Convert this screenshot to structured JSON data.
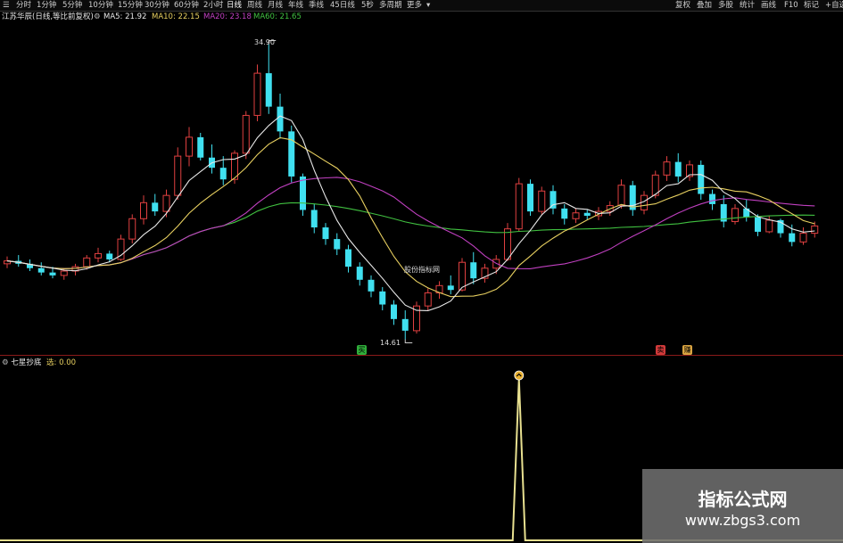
{
  "toolbar": {
    "items": [
      {
        "label": "分时"
      },
      {
        "label": "1分钟"
      },
      {
        "label": "5分钟"
      },
      {
        "label": "10分钟"
      },
      {
        "label": "15分钟"
      },
      {
        "label": "30分钟"
      },
      {
        "label": "60分钟"
      },
      {
        "label": "2小时"
      },
      {
        "label": "日线",
        "active": true
      },
      {
        "label": "周线"
      },
      {
        "label": "月线"
      },
      {
        "label": "年线"
      },
      {
        "label": "季线"
      },
      {
        "label": "45日线"
      },
      {
        "label": "5秒"
      },
      {
        "label": "多周期"
      },
      {
        "label": "更多"
      }
    ],
    "right_items": [
      {
        "label": "复权"
      },
      {
        "label": "叠加"
      },
      {
        "label": "多股"
      },
      {
        "label": "统计"
      },
      {
        "label": "画线"
      },
      {
        "label": "F10"
      },
      {
        "label": "标记"
      },
      {
        "label": "+自选"
      }
    ]
  },
  "stock": {
    "name": "江苏华辰(日线,等比前复权)"
  },
  "ma_legend": [
    {
      "label": "MA5: 21.92",
      "color": "#e8e8e8"
    },
    {
      "label": "MA10: 22.15",
      "color": "#e8d060"
    },
    {
      "label": "MA20: 23.18",
      "color": "#c040c0"
    },
    {
      "label": "MA60: 21.65",
      "color": "#40c040"
    }
  ],
  "annotations": {
    "high_label": "34.90",
    "low_label": "14.61",
    "note_label": "股份指标网"
  },
  "markers": [
    {
      "label": "买",
      "color": "#2fae3a"
    },
    {
      "label": "卖",
      "color": "#d03a3a"
    },
    {
      "label": "赚",
      "color": "#d9a441"
    }
  ],
  "indicator": {
    "name": "七星抄底",
    "value_label": "选: 0.00"
  },
  "watermark": {
    "title": "指标公式网",
    "url": "www.zbgs3.com"
  },
  "colors": {
    "up": "#e04040",
    "down": "#40e0f0",
    "ma5": "#e8e8e8",
    "ma10": "#e8d060",
    "ma20": "#c040c0",
    "ma60": "#40c040",
    "signal": "#e8e090"
  },
  "chart_data": {
    "type": "candlestick",
    "ohlc": [
      [
        19.8,
        20.3,
        19.5,
        20.0
      ],
      [
        20.0,
        20.4,
        19.6,
        19.8
      ],
      [
        19.8,
        20.1,
        19.3,
        19.5
      ],
      [
        19.5,
        19.9,
        19.0,
        19.2
      ],
      [
        19.2,
        19.6,
        18.8,
        19.0
      ],
      [
        19.0,
        19.5,
        18.7,
        19.3
      ],
      [
        19.3,
        19.8,
        19.0,
        19.6
      ],
      [
        19.6,
        20.4,
        19.4,
        20.2
      ],
      [
        20.2,
        20.9,
        19.9,
        20.5
      ],
      [
        20.5,
        20.7,
        19.9,
        20.1
      ],
      [
        20.1,
        21.8,
        20.0,
        21.5
      ],
      [
        21.5,
        23.2,
        21.2,
        22.9
      ],
      [
        22.9,
        24.5,
        22.5,
        24.0
      ],
      [
        24.0,
        24.6,
        23.1,
        23.4
      ],
      [
        23.4,
        24.9,
        23.0,
        24.5
      ],
      [
        24.5,
        27.8,
        24.2,
        27.2
      ],
      [
        27.2,
        29.2,
        26.5,
        28.5
      ],
      [
        28.5,
        28.8,
        26.9,
        27.1
      ],
      [
        27.1,
        28.0,
        26.0,
        26.4
      ],
      [
        26.4,
        27.2,
        25.2,
        25.6
      ],
      [
        25.6,
        27.6,
        25.3,
        27.4
      ],
      [
        27.4,
        30.3,
        27.0,
        30.0
      ],
      [
        30.0,
        33.5,
        29.6,
        32.9
      ],
      [
        32.9,
        34.9,
        30.1,
        30.6
      ],
      [
        30.6,
        31.5,
        28.4,
        28.9
      ],
      [
        28.9,
        29.3,
        25.4,
        25.8
      ],
      [
        25.8,
        26.0,
        23.1,
        23.5
      ],
      [
        23.5,
        23.9,
        21.9,
        22.3
      ],
      [
        22.3,
        22.6,
        21.1,
        21.5
      ],
      [
        21.5,
        21.9,
        20.4,
        20.8
      ],
      [
        20.8,
        21.1,
        19.2,
        19.6
      ],
      [
        19.6,
        19.9,
        18.3,
        18.7
      ],
      [
        18.7,
        19.0,
        17.5,
        17.9
      ],
      [
        17.9,
        18.2,
        16.6,
        17.0
      ],
      [
        17.0,
        17.3,
        15.6,
        16.0
      ],
      [
        16.0,
        16.6,
        14.61,
        15.2
      ],
      [
        15.2,
        17.2,
        15.0,
        16.9
      ],
      [
        16.9,
        18.1,
        16.6,
        17.8
      ],
      [
        17.8,
        18.6,
        17.4,
        18.3
      ],
      [
        18.3,
        19.0,
        17.7,
        18.0
      ],
      [
        18.0,
        20.2,
        17.9,
        19.9
      ],
      [
        19.9,
        20.6,
        18.4,
        18.8
      ],
      [
        18.8,
        19.8,
        18.5,
        19.5
      ],
      [
        19.5,
        20.4,
        19.1,
        20.1
      ],
      [
        20.1,
        22.6,
        20.0,
        22.2
      ],
      [
        22.2,
        25.7,
        22.0,
        25.3
      ],
      [
        25.3,
        25.6,
        23.1,
        23.4
      ],
      [
        23.4,
        25.1,
        23.2,
        24.8
      ],
      [
        24.8,
        25.2,
        23.2,
        23.6
      ],
      [
        23.6,
        23.9,
        22.5,
        22.9
      ],
      [
        22.9,
        23.6,
        22.6,
        23.3
      ],
      [
        23.3,
        23.5,
        22.8,
        23.1
      ],
      [
        23.1,
        23.7,
        22.8,
        23.4
      ],
      [
        23.4,
        24.1,
        23.1,
        23.8
      ],
      [
        23.8,
        25.6,
        23.6,
        25.2
      ],
      [
        25.2,
        25.5,
        23.1,
        23.5
      ],
      [
        23.5,
        24.8,
        23.2,
        24.5
      ],
      [
        24.5,
        26.2,
        24.3,
        25.9
      ],
      [
        25.9,
        27.2,
        25.5,
        26.8
      ],
      [
        26.8,
        27.4,
        25.4,
        25.8
      ],
      [
        25.8,
        26.9,
        25.5,
        26.6
      ],
      [
        26.6,
        26.9,
        24.2,
        24.6
      ],
      [
        24.6,
        24.9,
        23.5,
        23.9
      ],
      [
        23.9,
        24.5,
        22.3,
        22.7
      ],
      [
        22.7,
        23.9,
        22.5,
        23.6
      ],
      [
        23.6,
        24.2,
        22.7,
        23.0
      ],
      [
        23.0,
        23.2,
        21.7,
        22.0
      ],
      [
        22.0,
        23.1,
        21.9,
        22.8
      ],
      [
        22.8,
        22.9,
        21.6,
        21.9
      ],
      [
        21.9,
        22.5,
        21.0,
        21.3
      ],
      [
        21.3,
        22.3,
        21.1,
        21.9
      ],
      [
        21.9,
        22.7,
        21.6,
        22.4
      ]
    ],
    "y_range": [
      13.6,
      36.4
    ],
    "signal_peak_index": 45
  }
}
